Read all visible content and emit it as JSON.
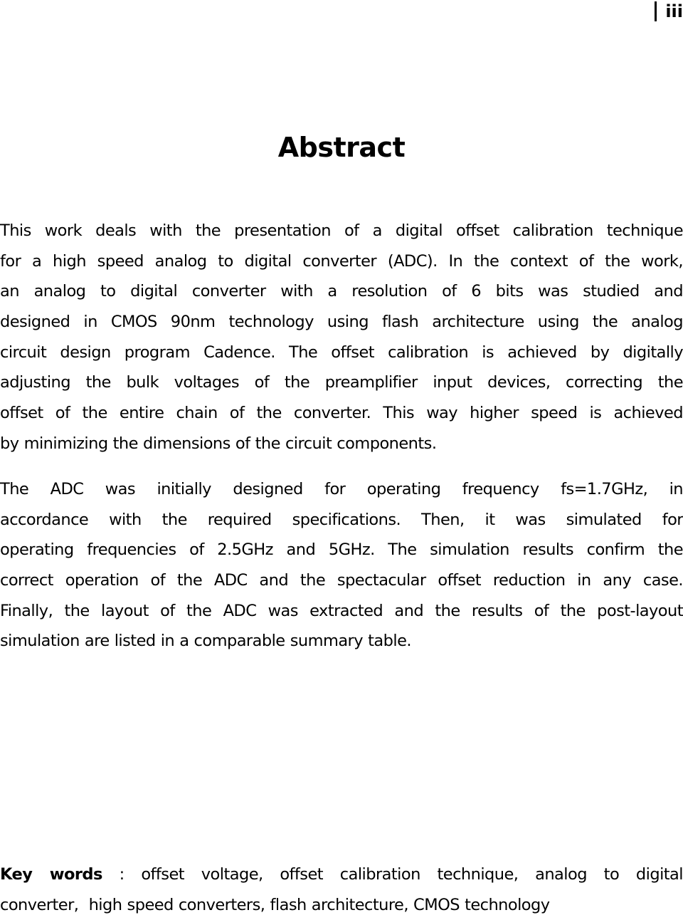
{
  "header": {
    "page_number": "iii"
  },
  "title": "Abstract",
  "paragraphs": [
    {
      "lines": [
        "This work deals with the presentation of a digital offset calibration technique",
        "for a high speed analog to digital converter (ADC). In the context of the work,",
        "an analog to digital converter with a resolution of 6 bits was studied and",
        "designed in CMOS 90nm technology using flash architecture using the analog",
        "circuit design program Cadence. The offset calibration is achieved by digitally",
        "adjusting the bulk voltages of the preamplifier input devices, correcting the",
        "offset of the entire chain of the converter. This way higher speed is achieved",
        "by minimizing the dimensions of the circuit components."
      ]
    },
    {
      "lines": [
        "The ADC was initially designed for operating frequency fs=1.7GHz, in",
        "accordance with the required specifications. Then, it was simulated for",
        "operating frequencies of 2.5GHz and 5GHz. The simulation results confirm the",
        "correct operation of the ADC and the spectacular offset reduction in any case.",
        "Finally, the layout of the ADC was extracted and the results of the post-layout",
        "simulation are listed in a comparable summary table."
      ]
    }
  ],
  "keywords": {
    "label": "Key words",
    "separator": " : ",
    "line1": "offset voltage, offset calibration technique, analog to digital",
    "line2": "converter,  high speed converters, flash architecture, CMOS technology"
  }
}
